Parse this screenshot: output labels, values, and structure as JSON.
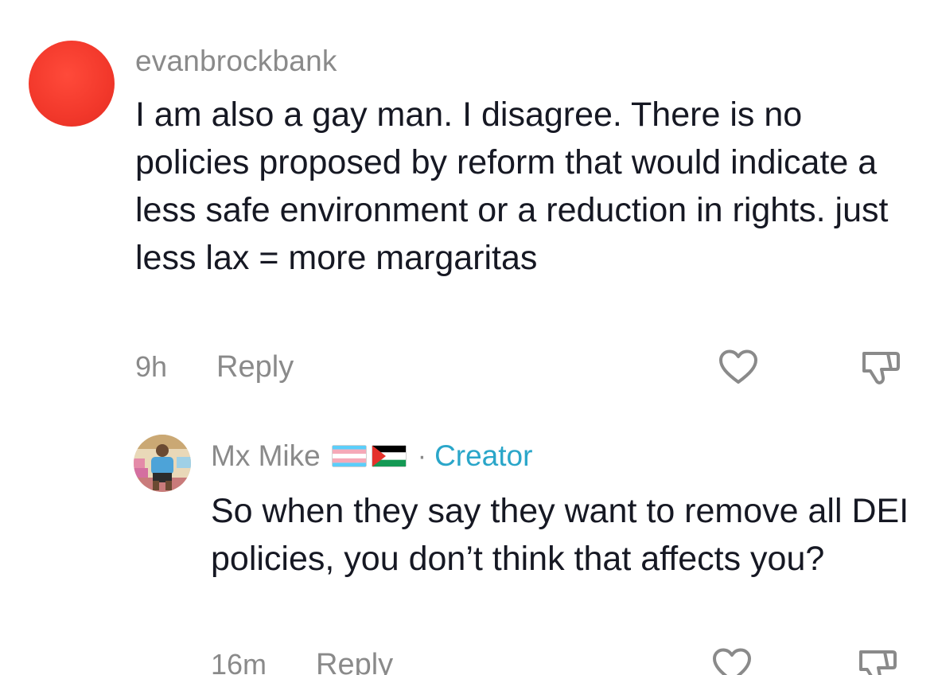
{
  "comments": [
    {
      "username": "evanbrockbank",
      "text": "I am also a gay man. I disagree. There is no policies proposed by reform that would indicate a less safe environment or a reduction in rights. just less lax = more margaritas",
      "time": "9h",
      "reply_label": "Reply",
      "avatar_color": "#f2382b",
      "like_icon": "heart-outline-icon",
      "dislike_icon": "thumbs-down-outline-icon"
    },
    {
      "username": "Mx Mike",
      "flags": [
        "transgender-flag-icon",
        "palestine-flag-icon"
      ],
      "separator": "·",
      "badge": "Creator",
      "badge_color": "#2aa6c9",
      "text": "So when they say they want to remove all DEI policies, you don’t think that affects you?",
      "time": "16m",
      "reply_label": "Reply",
      "like_icon": "heart-outline-icon",
      "dislike_icon": "thumbs-down-outline-icon"
    }
  ]
}
